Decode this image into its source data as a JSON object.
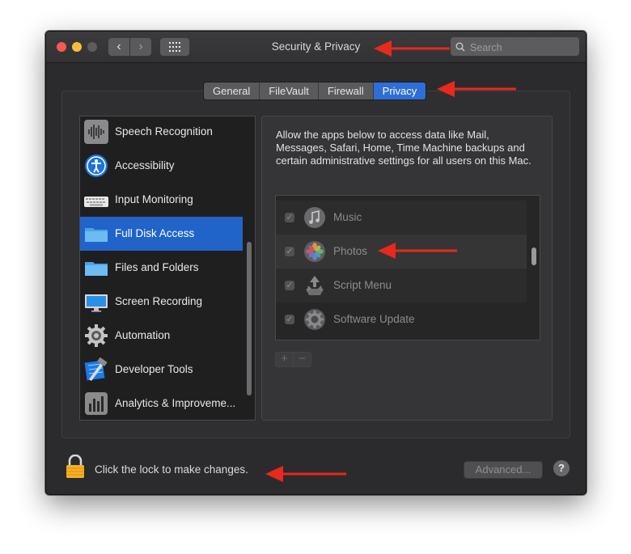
{
  "window": {
    "title": "Security & Privacy",
    "search_placeholder": "Search"
  },
  "tabs": [
    {
      "label": "General",
      "active": false
    },
    {
      "label": "FileVault",
      "active": false
    },
    {
      "label": "Firewall",
      "active": false
    },
    {
      "label": "Privacy",
      "active": true
    }
  ],
  "sidebar": {
    "items": [
      {
        "label": "Speech Recognition",
        "icon": "waveform-icon"
      },
      {
        "label": "Accessibility",
        "icon": "accessibility-icon"
      },
      {
        "label": "Input Monitoring",
        "icon": "keyboard-icon"
      },
      {
        "label": "Full Disk Access",
        "icon": "folder-icon",
        "selected": true
      },
      {
        "label": "Files and Folders",
        "icon": "folder-icon"
      },
      {
        "label": "Screen Recording",
        "icon": "display-icon"
      },
      {
        "label": "Automation",
        "icon": "gear-icon"
      },
      {
        "label": "Developer Tools",
        "icon": "xcode-hammer-icon"
      },
      {
        "label": "Analytics & Improveme...",
        "icon": "bar-chart-icon"
      }
    ]
  },
  "main": {
    "description": "Allow the apps below to access data like Mail, Messages, Safari, Home, Time Machine backups and certain administrative settings for all users on this Mac.",
    "apps": [
      {
        "label": "Music",
        "checked": true,
        "icon": "music-note-icon"
      },
      {
        "label": "Photos",
        "checked": true,
        "icon": "photos-flower-icon"
      },
      {
        "label": "Script Menu",
        "checked": true,
        "icon": "script-menu-icon"
      },
      {
        "label": "Software Update",
        "checked": true,
        "icon": "gear-icon"
      }
    ],
    "add_label": "+",
    "remove_label": "−"
  },
  "footer": {
    "lock_text": "Click the lock to make changes.",
    "advanced_label": "Advanced...",
    "help_label": "?"
  },
  "colors": {
    "annotation_arrow": "#e8291c",
    "selection": "#2064c9",
    "active_tab": "#2d6fd6"
  }
}
